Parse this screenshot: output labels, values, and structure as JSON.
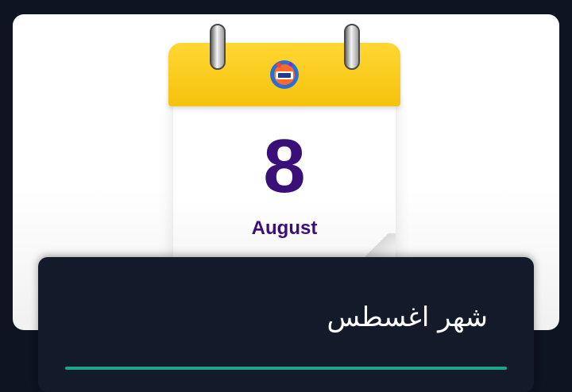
{
  "calendar": {
    "day": "8",
    "month": "August",
    "header_color": "#f6c20c",
    "text_color": "#3a1078",
    "logo_icon": "festival-logo"
  },
  "panel": {
    "title": "شهر اغسطس",
    "accent_color": "#1fa38a"
  }
}
